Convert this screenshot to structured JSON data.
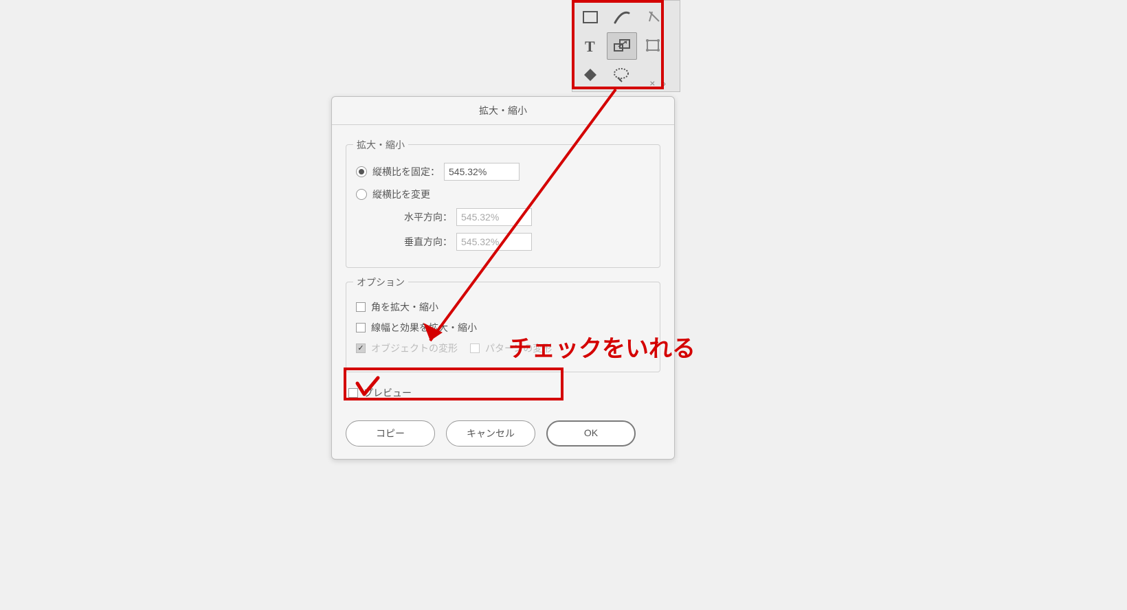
{
  "annotation": {
    "text": "チェックをいれる"
  },
  "tool_panel": {
    "selected_tool": "scale-tool"
  },
  "dialog": {
    "title": "拡大・縮小",
    "section_scale": {
      "label": "拡大・縮小",
      "lock_aspect": {
        "label": "縦横比を固定：",
        "value": "545.32%",
        "selected": true
      },
      "change_aspect": {
        "label": "縦横比を変更",
        "selected": false
      },
      "horizontal": {
        "label": "水平方向：",
        "value": "545.32%"
      },
      "vertical": {
        "label": "垂直方向：",
        "value": "545.32%"
      }
    },
    "section_options": {
      "label": "オプション",
      "scale_corners": {
        "label": "角を拡大・縮小",
        "checked": false
      },
      "scale_strokes": {
        "label": "線幅と効果を拡大・縮小",
        "checked": false
      },
      "transform_objects": {
        "label": "オブジェクトの変形",
        "checked": true,
        "disabled": true
      },
      "transform_patterns": {
        "label": "パターンの変形",
        "checked": false,
        "disabled": true
      }
    },
    "preview": {
      "label": "プレビュー",
      "checked": false
    },
    "buttons": {
      "copy": "コピー",
      "cancel": "キャンセル",
      "ok": "OK"
    }
  }
}
